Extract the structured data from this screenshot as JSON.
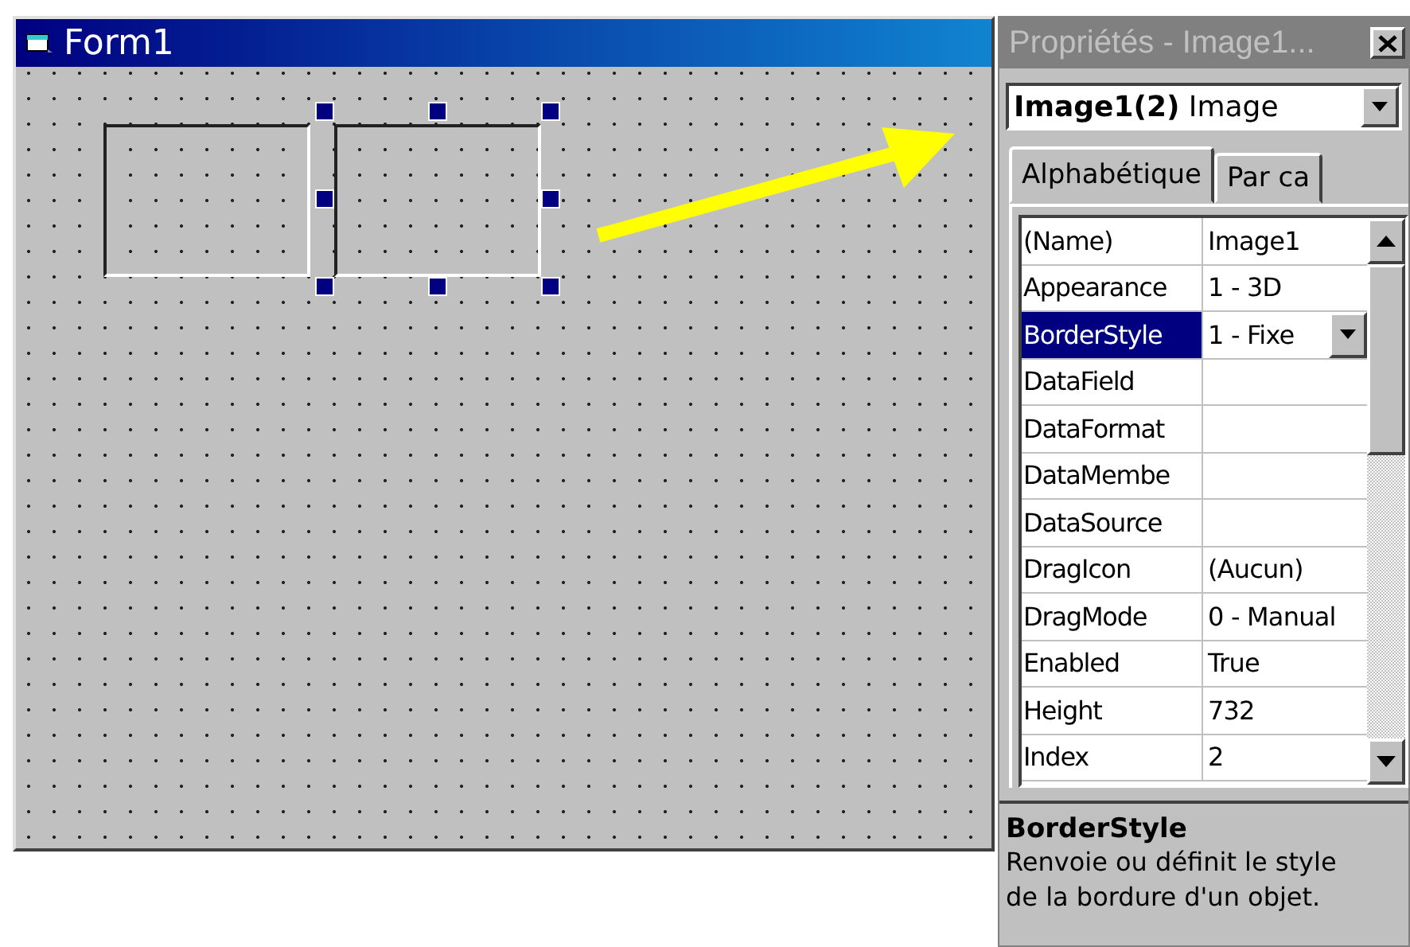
{
  "form": {
    "title": "Form1",
    "images": [
      {
        "selected": false
      },
      {
        "selected": true
      }
    ]
  },
  "properties": {
    "title": "Propriétés - Image1...",
    "object": "**Image1(2)** Image",
    "tabs": [
      {
        "label": "Alphabétique",
        "selected": true
      },
      {
        "label": "Par ca",
        "selected": false
      }
    ],
    "rows": [
      {
        "name": "(Name)",
        "value": "Image1",
        "selected": false,
        "kind": "text"
      },
      {
        "name": "Appearance",
        "value": "1 - 3D",
        "selected": false,
        "kind": "text"
      },
      {
        "name": "BorderStyle",
        "value": "1 - Fixe",
        "selected": true,
        "kind": "dropdown"
      },
      {
        "name": "DataField",
        "value": "",
        "selected": false,
        "kind": "text"
      },
      {
        "name": "DataFormat",
        "value": "",
        "selected": false,
        "kind": "text"
      },
      {
        "name": "DataMembe",
        "value": "",
        "selected": false,
        "kind": "text"
      },
      {
        "name": "DataSource",
        "value": "",
        "selected": false,
        "kind": "text"
      },
      {
        "name": "DragIcon",
        "value": "(Aucun)",
        "selected": false,
        "kind": "text"
      },
      {
        "name": "DragMode",
        "value": "0 - Manual",
        "selected": false,
        "kind": "text"
      },
      {
        "name": "Enabled",
        "value": "True",
        "selected": false,
        "kind": "text"
      },
      {
        "name": "Height",
        "value": "732",
        "selected": false,
        "kind": "text"
      },
      {
        "name": "Index",
        "value": "2",
        "selected": false,
        "kind": "text"
      }
    ],
    "description": {
      "title": "BorderStyle",
      "text": "Renvoie ou définit le style de la bordure d'un objet."
    }
  }
}
